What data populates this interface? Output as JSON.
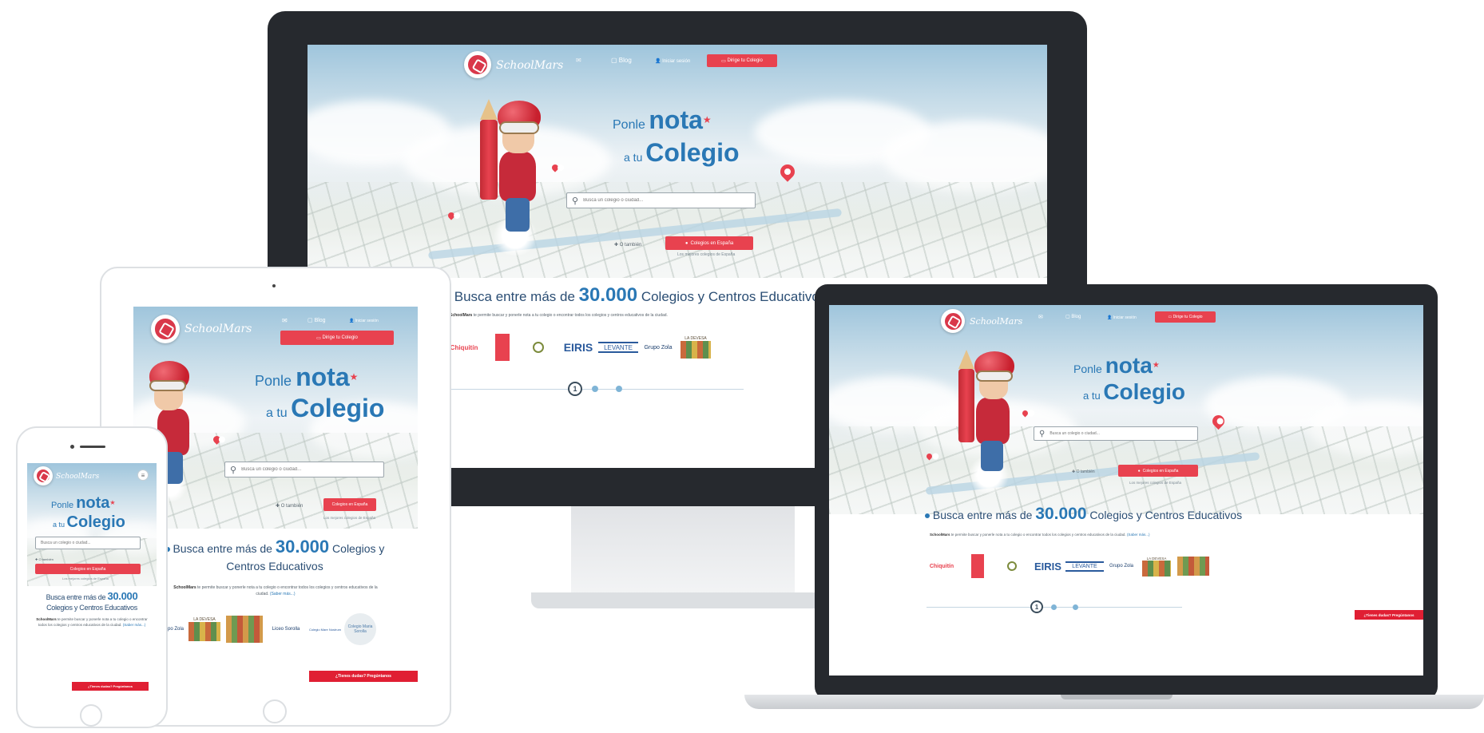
{
  "brand": "SchoolMars",
  "nav": {
    "blog": "Blog",
    "login": "Iniciar sesión",
    "manage_school": "Dirige tu Colegio"
  },
  "hero": {
    "tag_small_1": "Ponle",
    "tag_big_1": "nota",
    "tag_small_2": "a tu",
    "tag_big_2": "Colegio",
    "star": "★",
    "search_placeholder": "Busca un colegio o ciudad...",
    "search_icon": "magnifier-icon",
    "also_link": "O también",
    "spain_button": "Colegios en España",
    "spain_sub": "Los mejores colegios de España"
  },
  "content": {
    "headline_pre": "Busca entre más de",
    "headline_num": "30.000",
    "headline_post": "Colegios y Centros Educativos",
    "tablet_headline_post_1": "Colegios y",
    "tablet_headline_post_2": "Centros Educativos",
    "phone_headline_post_1": "Colegios y Centros Educativos",
    "desc_brand": "SchoolMars",
    "desc_text": "te permite buscar y ponerle nota a tu colegio o encontrar todos los colegios y centros educativos de la ciudad.",
    "desc_more": "(Saber más...)",
    "page_number": "1",
    "help_button": "¿Tienes dudas? Pregúntanos"
  },
  "partner_logos": [
    "Chiquitín",
    "EIRIS",
    "LEVANTE",
    "Grupo Zola",
    "LA DEVESA",
    "Liceo Sorolla",
    "Colegio Mare Nostrum",
    "Colegio Maria Sorolla"
  ]
}
